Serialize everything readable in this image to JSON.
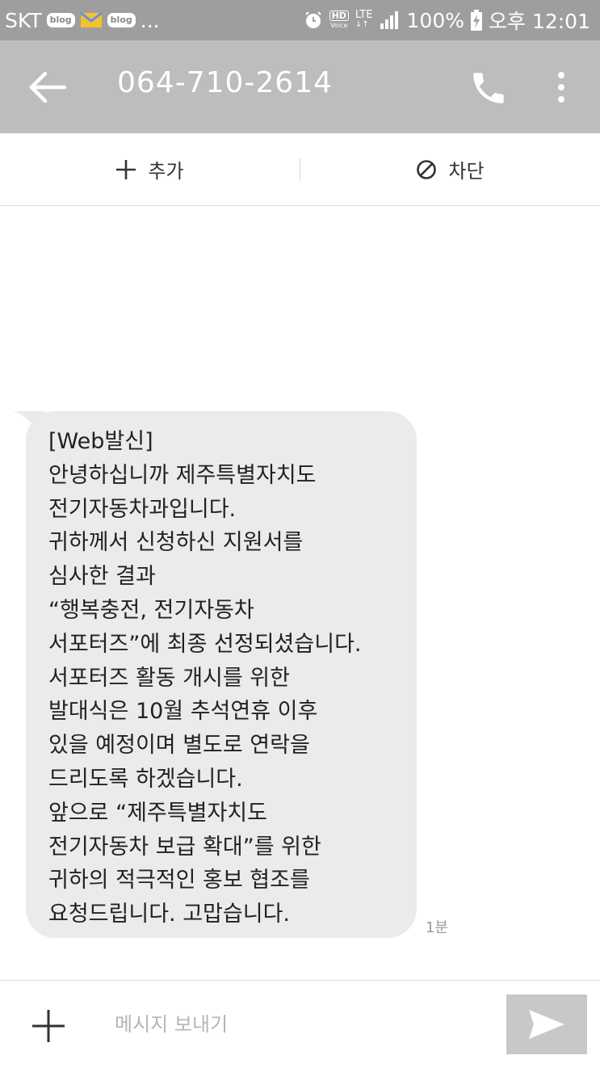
{
  "status_bar": {
    "carrier": "SKT",
    "notif1": "blog",
    "notif2": "blog",
    "more": "...",
    "hd": "HD",
    "hd_sub": "Voice",
    "lte": "LTE",
    "battery": "100%",
    "time": "오후 12:01",
    "icons": [
      "blog-icon",
      "mail-icon",
      "blog-icon",
      "alarm-icon",
      "hd-voice-icon",
      "lte-icon",
      "signal-icon",
      "battery-charging-icon"
    ]
  },
  "header": {
    "title": "064-710-2614",
    "icons": [
      "back-arrow-icon",
      "phone-icon",
      "more-vert-icon"
    ]
  },
  "actions": {
    "add_label": "추가",
    "block_label": "차단",
    "icons": [
      "plus-icon",
      "block-icon"
    ]
  },
  "message": {
    "text": "[Web발신]\n안녕하십니까 제주특별자치도\n전기자동차과입니다.\n귀하께서 신청하신 지원서를\n심사한 결과\n“행복충전, 전기자동차\n서포터즈”에 최종 선정되셨습니다.\n서포터즈 활동 개시를 위한\n발대식은 10월 추석연휴 이후\n있을 예정이며 별도로 연락을\n드리도록 하겠습니다.\n앞으로 “제주특별자치도\n전기자동차 보급 확대”를 위한\n귀하의 적극적인 홍보 협조를\n요청드립니다. 고맙습니다.",
    "time": "1분"
  },
  "composer": {
    "placeholder": "메시지 보내기",
    "value": "",
    "icons": [
      "plus-icon",
      "send-icon"
    ]
  },
  "colors": {
    "status_bar": "#9e9e9e",
    "app_bar": "#bdbdbd",
    "bubble": "#ebebeb",
    "send_button": "#c8c8c8"
  }
}
